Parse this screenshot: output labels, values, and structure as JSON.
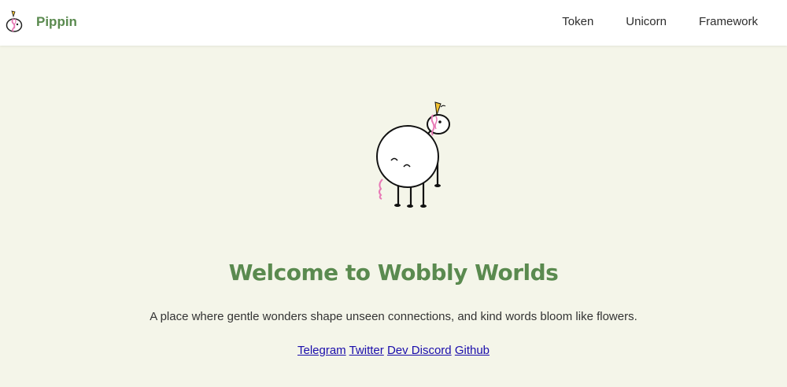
{
  "header": {
    "brand_name": "Pippin",
    "logo_icon": "pippin-unicorn-logo-icon",
    "nav": [
      {
        "label": "Token"
      },
      {
        "label": "Unicorn"
      },
      {
        "label": "Framework"
      }
    ]
  },
  "hero": {
    "illustration_icon": "pippin-unicorn-illustration-icon",
    "title": "Welcome to Wobbly Worlds",
    "subtitle": "A place where gentle wonders shape unseen connections, and kind words bloom like flowers."
  },
  "social": {
    "links": [
      {
        "label": "Telegram"
      },
      {
        "label": "Twitter"
      },
      {
        "label": "Dev Discord"
      },
      {
        "label": "Github"
      }
    ]
  },
  "colors": {
    "page_background": "#f4f5e9",
    "header_background": "#ffffff",
    "brand_green": "#5a8a4f",
    "link_blue": "#1a0dab",
    "accent_pink": "#e879b6",
    "accent_yellow": "#f2c230"
  }
}
